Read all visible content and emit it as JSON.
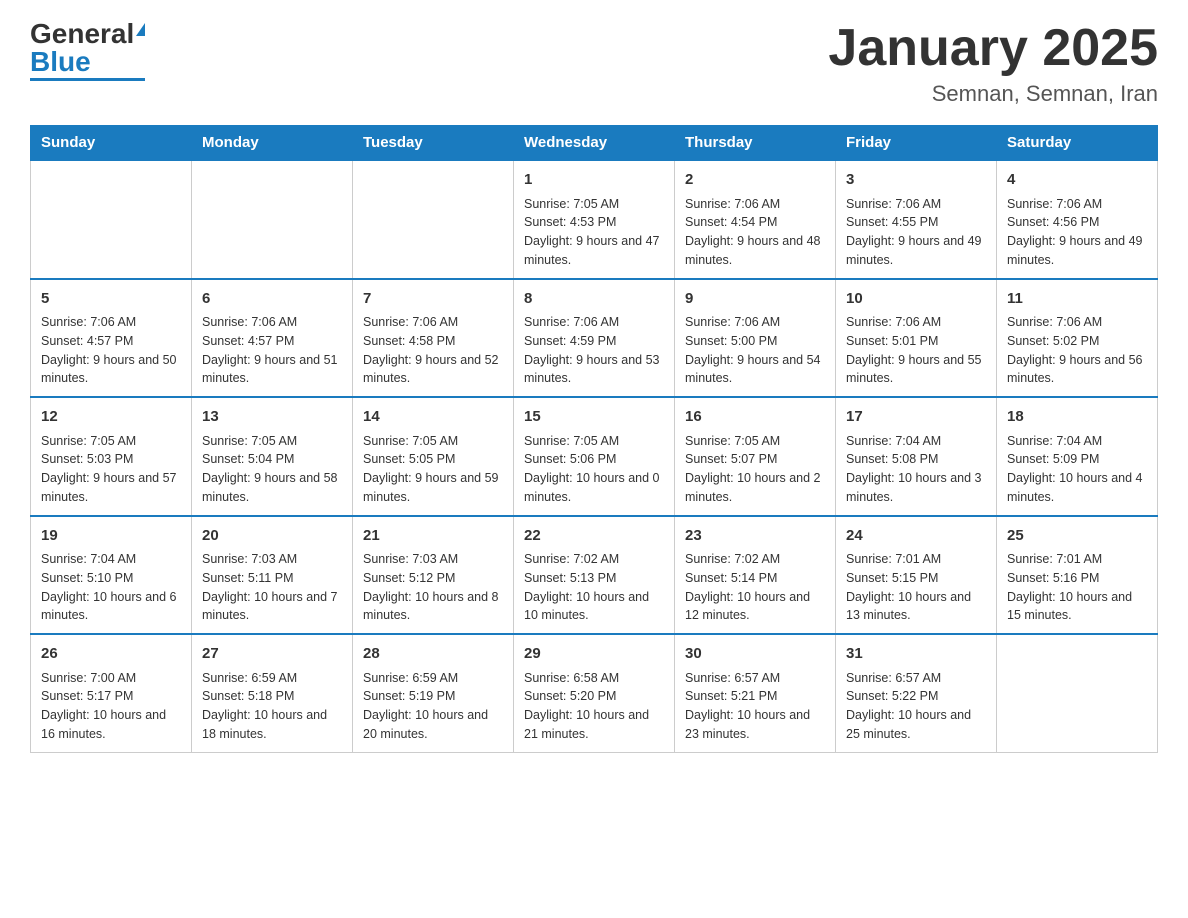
{
  "header": {
    "logo_general": "General",
    "logo_blue": "Blue",
    "month_title": "January 2025",
    "location": "Semnan, Semnan, Iran"
  },
  "days_of_week": [
    "Sunday",
    "Monday",
    "Tuesday",
    "Wednesday",
    "Thursday",
    "Friday",
    "Saturday"
  ],
  "weeks": [
    [
      {
        "day": "",
        "info": ""
      },
      {
        "day": "",
        "info": ""
      },
      {
        "day": "",
        "info": ""
      },
      {
        "day": "1",
        "info": "Sunrise: 7:05 AM\nSunset: 4:53 PM\nDaylight: 9 hours and 47 minutes."
      },
      {
        "day": "2",
        "info": "Sunrise: 7:06 AM\nSunset: 4:54 PM\nDaylight: 9 hours and 48 minutes."
      },
      {
        "day": "3",
        "info": "Sunrise: 7:06 AM\nSunset: 4:55 PM\nDaylight: 9 hours and 49 minutes."
      },
      {
        "day": "4",
        "info": "Sunrise: 7:06 AM\nSunset: 4:56 PM\nDaylight: 9 hours and 49 minutes."
      }
    ],
    [
      {
        "day": "5",
        "info": "Sunrise: 7:06 AM\nSunset: 4:57 PM\nDaylight: 9 hours and 50 minutes."
      },
      {
        "day": "6",
        "info": "Sunrise: 7:06 AM\nSunset: 4:57 PM\nDaylight: 9 hours and 51 minutes."
      },
      {
        "day": "7",
        "info": "Sunrise: 7:06 AM\nSunset: 4:58 PM\nDaylight: 9 hours and 52 minutes."
      },
      {
        "day": "8",
        "info": "Sunrise: 7:06 AM\nSunset: 4:59 PM\nDaylight: 9 hours and 53 minutes."
      },
      {
        "day": "9",
        "info": "Sunrise: 7:06 AM\nSunset: 5:00 PM\nDaylight: 9 hours and 54 minutes."
      },
      {
        "day": "10",
        "info": "Sunrise: 7:06 AM\nSunset: 5:01 PM\nDaylight: 9 hours and 55 minutes."
      },
      {
        "day": "11",
        "info": "Sunrise: 7:06 AM\nSunset: 5:02 PM\nDaylight: 9 hours and 56 minutes."
      }
    ],
    [
      {
        "day": "12",
        "info": "Sunrise: 7:05 AM\nSunset: 5:03 PM\nDaylight: 9 hours and 57 minutes."
      },
      {
        "day": "13",
        "info": "Sunrise: 7:05 AM\nSunset: 5:04 PM\nDaylight: 9 hours and 58 minutes."
      },
      {
        "day": "14",
        "info": "Sunrise: 7:05 AM\nSunset: 5:05 PM\nDaylight: 9 hours and 59 minutes."
      },
      {
        "day": "15",
        "info": "Sunrise: 7:05 AM\nSunset: 5:06 PM\nDaylight: 10 hours and 0 minutes."
      },
      {
        "day": "16",
        "info": "Sunrise: 7:05 AM\nSunset: 5:07 PM\nDaylight: 10 hours and 2 minutes."
      },
      {
        "day": "17",
        "info": "Sunrise: 7:04 AM\nSunset: 5:08 PM\nDaylight: 10 hours and 3 minutes."
      },
      {
        "day": "18",
        "info": "Sunrise: 7:04 AM\nSunset: 5:09 PM\nDaylight: 10 hours and 4 minutes."
      }
    ],
    [
      {
        "day": "19",
        "info": "Sunrise: 7:04 AM\nSunset: 5:10 PM\nDaylight: 10 hours and 6 minutes."
      },
      {
        "day": "20",
        "info": "Sunrise: 7:03 AM\nSunset: 5:11 PM\nDaylight: 10 hours and 7 minutes."
      },
      {
        "day": "21",
        "info": "Sunrise: 7:03 AM\nSunset: 5:12 PM\nDaylight: 10 hours and 8 minutes."
      },
      {
        "day": "22",
        "info": "Sunrise: 7:02 AM\nSunset: 5:13 PM\nDaylight: 10 hours and 10 minutes."
      },
      {
        "day": "23",
        "info": "Sunrise: 7:02 AM\nSunset: 5:14 PM\nDaylight: 10 hours and 12 minutes."
      },
      {
        "day": "24",
        "info": "Sunrise: 7:01 AM\nSunset: 5:15 PM\nDaylight: 10 hours and 13 minutes."
      },
      {
        "day": "25",
        "info": "Sunrise: 7:01 AM\nSunset: 5:16 PM\nDaylight: 10 hours and 15 minutes."
      }
    ],
    [
      {
        "day": "26",
        "info": "Sunrise: 7:00 AM\nSunset: 5:17 PM\nDaylight: 10 hours and 16 minutes."
      },
      {
        "day": "27",
        "info": "Sunrise: 6:59 AM\nSunset: 5:18 PM\nDaylight: 10 hours and 18 minutes."
      },
      {
        "day": "28",
        "info": "Sunrise: 6:59 AM\nSunset: 5:19 PM\nDaylight: 10 hours and 20 minutes."
      },
      {
        "day": "29",
        "info": "Sunrise: 6:58 AM\nSunset: 5:20 PM\nDaylight: 10 hours and 21 minutes."
      },
      {
        "day": "30",
        "info": "Sunrise: 6:57 AM\nSunset: 5:21 PM\nDaylight: 10 hours and 23 minutes."
      },
      {
        "day": "31",
        "info": "Sunrise: 6:57 AM\nSunset: 5:22 PM\nDaylight: 10 hours and 25 minutes."
      },
      {
        "day": "",
        "info": ""
      }
    ]
  ]
}
